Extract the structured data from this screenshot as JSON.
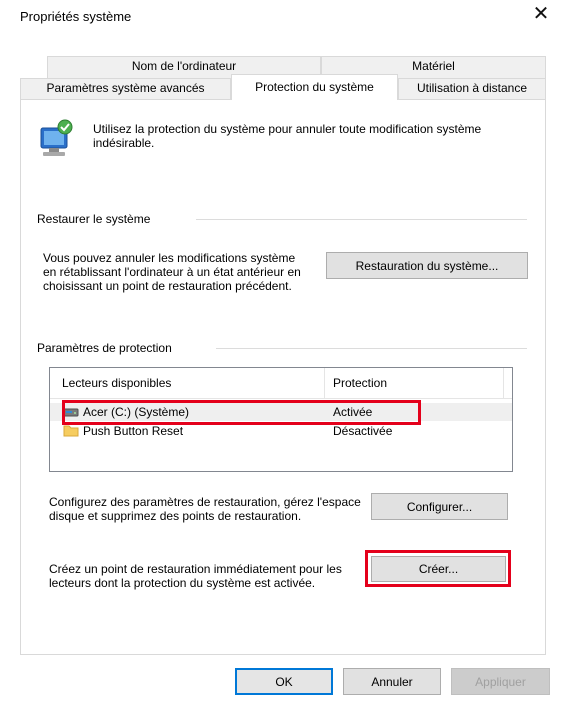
{
  "window": {
    "title": "Propriétés système"
  },
  "tabs": {
    "row_back": [
      "Nom de l'ordinateur",
      "Matériel"
    ],
    "row_front": [
      "Paramètres système avancés",
      "Protection du système",
      "Utilisation à distance"
    ],
    "active": "Protection du système"
  },
  "intro": {
    "text": "Utilisez la protection du système pour annuler toute modification système indésirable."
  },
  "restore": {
    "section_title": "Restaurer le système",
    "description": "Vous pouvez annuler les modifications système en rétablissant l'ordinateur à un état antérieur en choisissant un point de restauration précédent.",
    "button_label": "Restauration du système..."
  },
  "protection": {
    "section_title": "Paramètres de protection",
    "columns": [
      "Lecteurs disponibles",
      "Protection"
    ],
    "drives": [
      {
        "name": "Acer (C:) (Système)",
        "status": "Activée",
        "icon": "drive-icon",
        "highlighted": true
      },
      {
        "name": "Push Button Reset",
        "status": "Désactivée",
        "icon": "folder-icon",
        "highlighted": false
      }
    ],
    "configure_text": "Configurez des paramètres de restauration, gérez l'espace disque et supprimez des points de restauration.",
    "configure_button": "Configurer...",
    "create_text": "Créez un point de restauration immédiatement pour les lecteurs dont la protection du système est activée.",
    "create_button": "Créer..."
  },
  "footer": {
    "ok": "OK",
    "cancel": "Annuler",
    "apply": "Appliquer"
  },
  "colors": {
    "highlight": "#e4001b",
    "accent": "#0078d7"
  }
}
